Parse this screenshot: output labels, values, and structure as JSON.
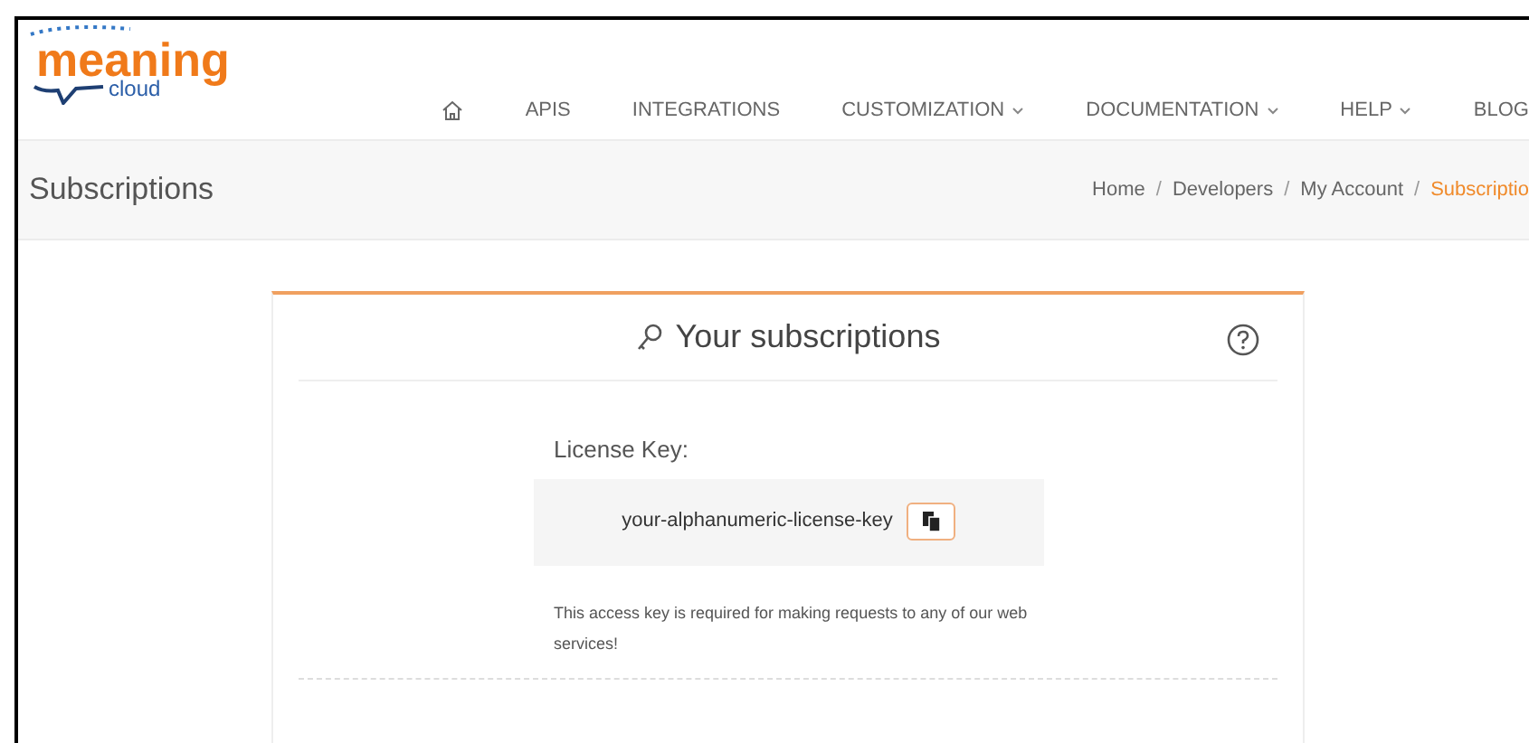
{
  "logo": {
    "word": "meaning",
    "sub": "cloud"
  },
  "nav": [
    {
      "kind": "home"
    },
    {
      "kind": "link",
      "label": "APIS",
      "has_menu": false
    },
    {
      "kind": "link",
      "label": "INTEGRATIONS",
      "has_menu": false
    },
    {
      "kind": "link",
      "label": "CUSTOMIZATION",
      "has_menu": true
    },
    {
      "kind": "link",
      "label": "DOCUMENTATION",
      "has_menu": true
    },
    {
      "kind": "link",
      "label": "HELP",
      "has_menu": true
    },
    {
      "kind": "link",
      "label": "BLOG",
      "has_menu": false
    }
  ],
  "page_title": "Subscriptions",
  "breadcrumb_separator": "/",
  "breadcrumb": [
    {
      "label": "Home",
      "current": false
    },
    {
      "label": "Developers",
      "current": false
    },
    {
      "label": "My Account",
      "current": false
    },
    {
      "label": "Subscriptio",
      "current": true
    }
  ],
  "card": {
    "title": "Your subscriptions",
    "license_label": "License Key:",
    "license_key": "your-alphanumeric-license-key",
    "note": "This access key is required for making requests to any of our web services!"
  }
}
